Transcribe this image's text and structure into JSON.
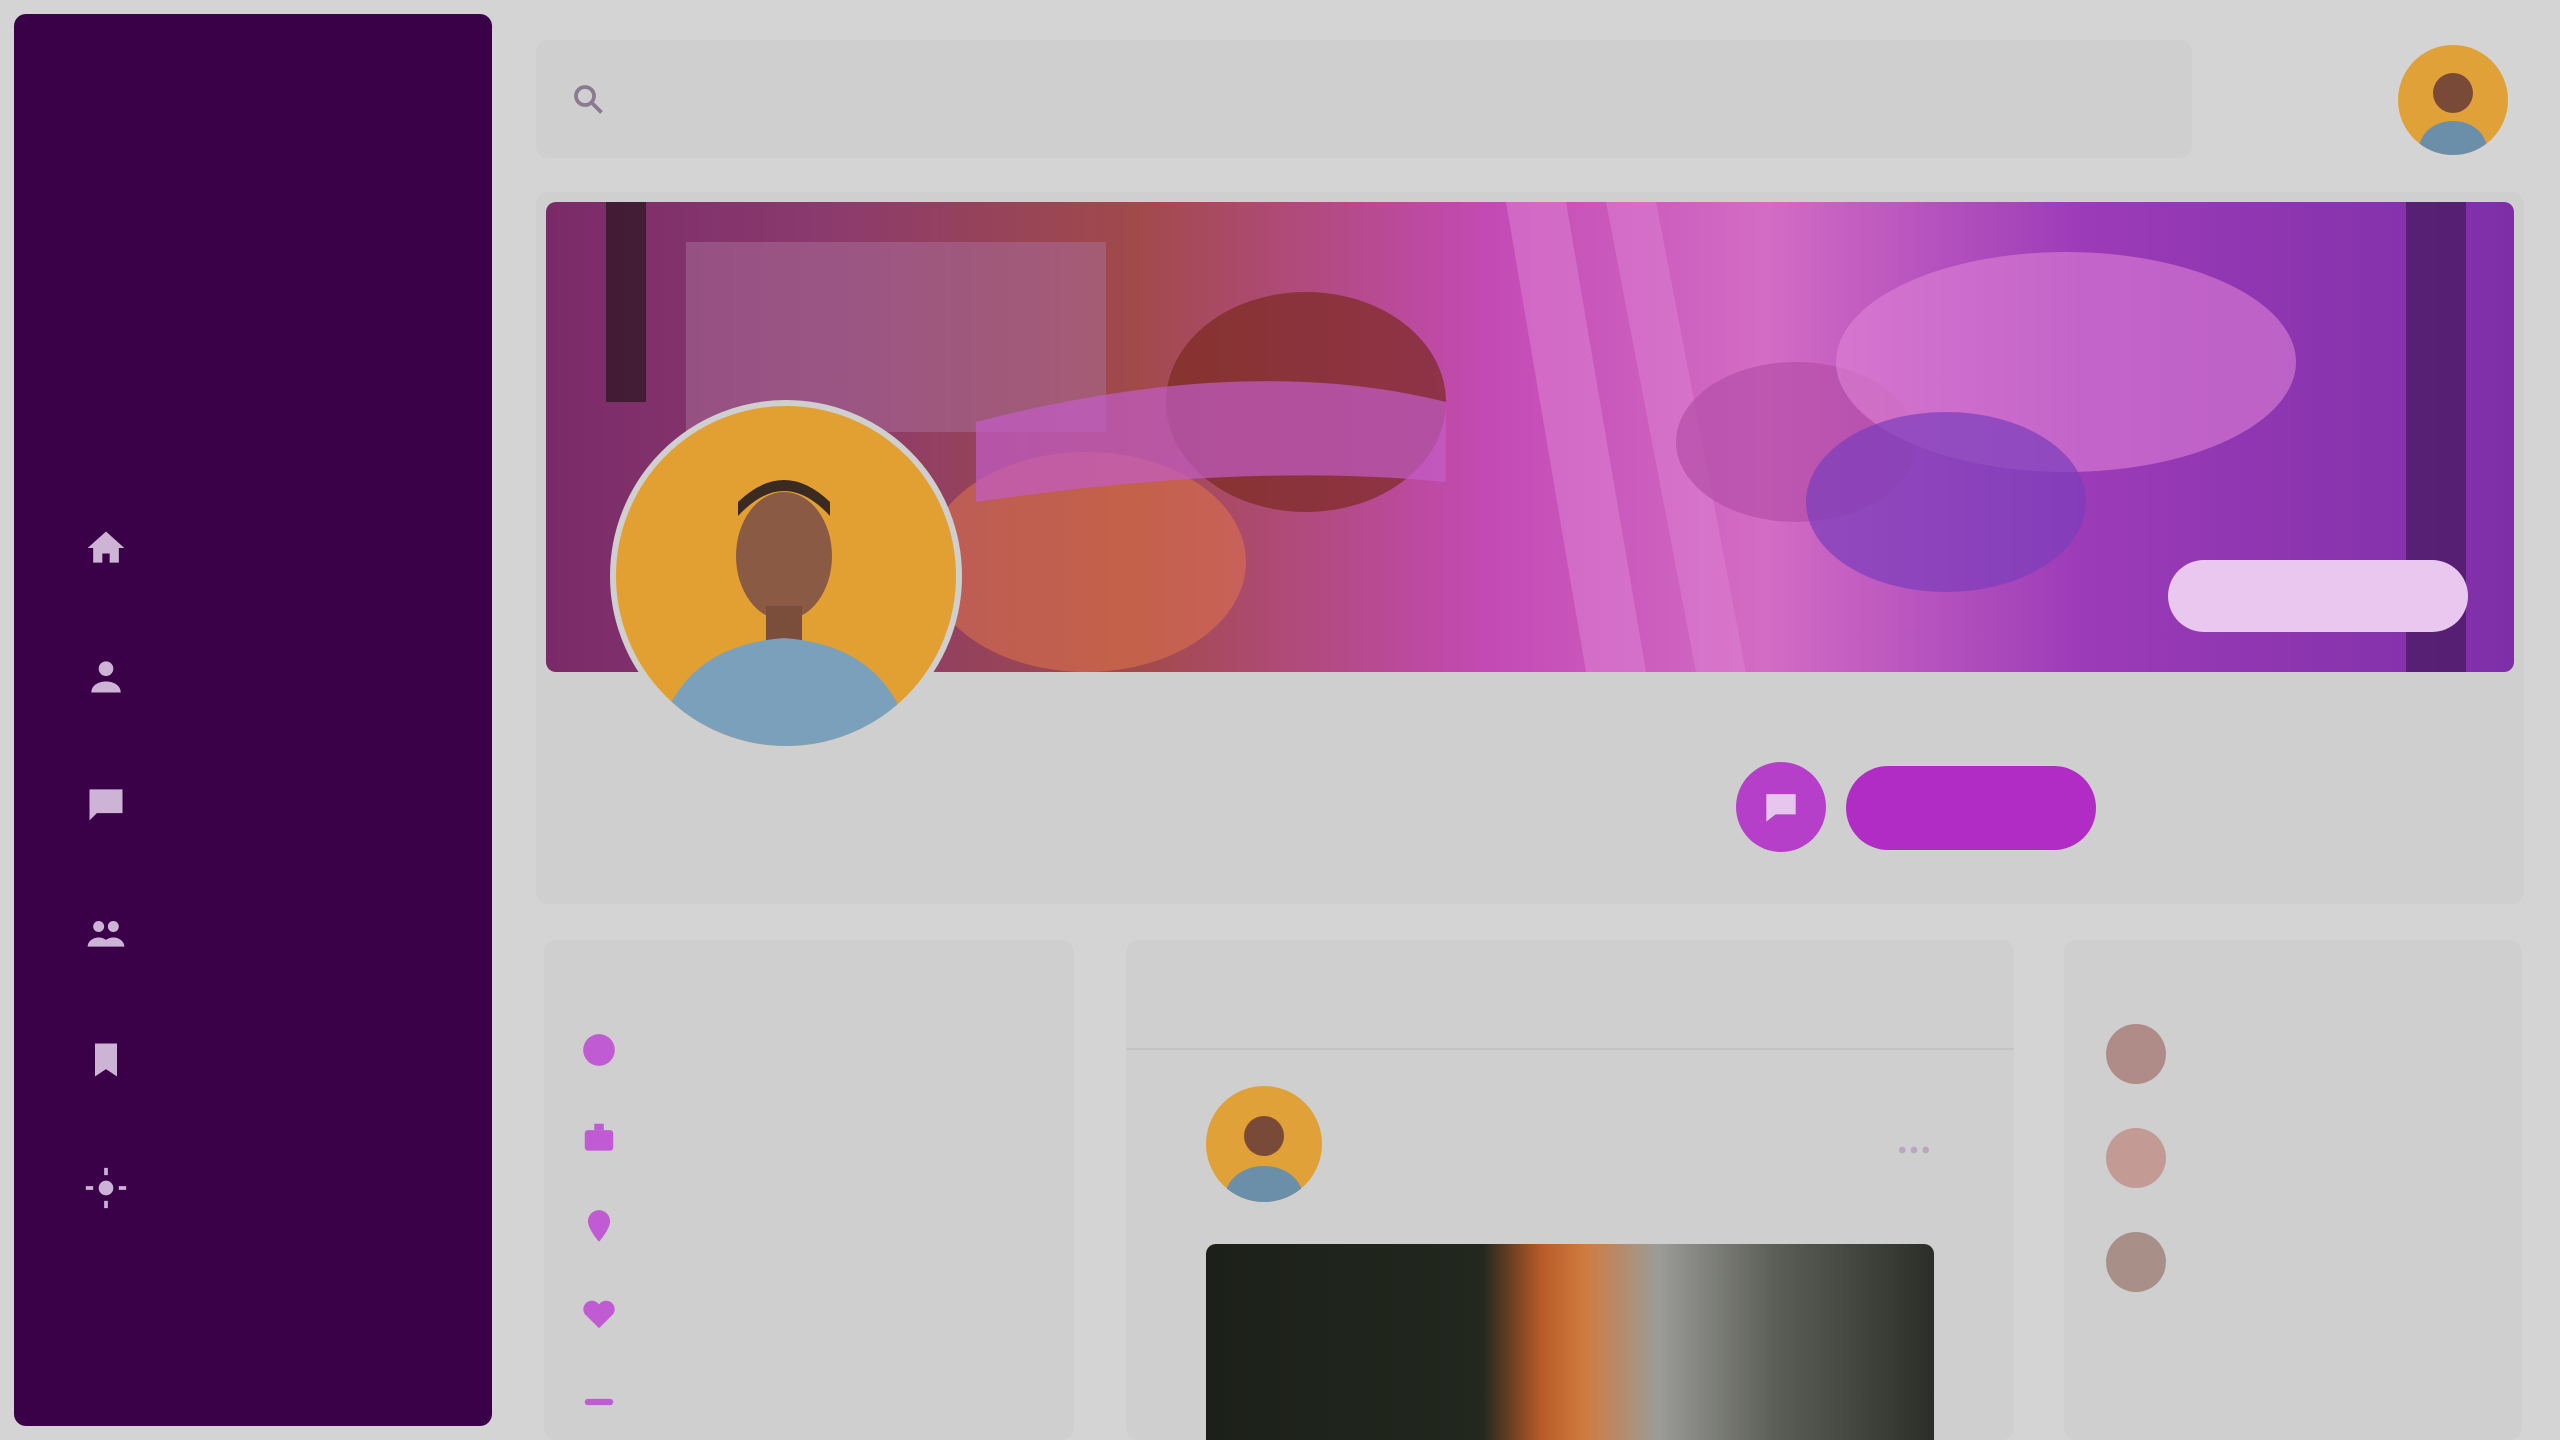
{
  "app": {
    "logo": "",
    "colors": {
      "sidebar": "#3a0048",
      "accent": "#b02cc4",
      "background": "#d4d4d4"
    }
  },
  "sidebar": {
    "items": [
      {
        "label": "",
        "icon": "home-icon"
      },
      {
        "label": "",
        "icon": "user-icon"
      },
      {
        "label": "",
        "icon": "message-icon"
      },
      {
        "label": "",
        "icon": "group-icon"
      },
      {
        "label": "",
        "icon": "bookmark-icon"
      },
      {
        "label": "",
        "icon": "settings-icon"
      }
    ]
  },
  "header": {
    "search_placeholder": "",
    "user_name": "",
    "user_subtitle": ""
  },
  "profile": {
    "name": "",
    "handle": "",
    "cover_button": "",
    "follow_button": "",
    "secondary_action": ""
  },
  "about": {
    "title": "",
    "rows": [
      {
        "text": "",
        "icon": "info-icon"
      },
      {
        "text": "",
        "icon": "briefcase-icon"
      },
      {
        "text": "",
        "icon": "location-icon"
      },
      {
        "text": "",
        "icon": "heart-icon"
      },
      {
        "text": "",
        "icon": "link-icon"
      }
    ]
  },
  "feed": {
    "tabs": [
      "",
      "",
      ""
    ],
    "post": {
      "author": "",
      "time": ""
    }
  },
  "suggestions": {
    "title": "",
    "items": [
      {
        "name": "",
        "subtitle": ""
      },
      {
        "name": "",
        "subtitle": ""
      },
      {
        "name": "",
        "subtitle": ""
      }
    ]
  }
}
